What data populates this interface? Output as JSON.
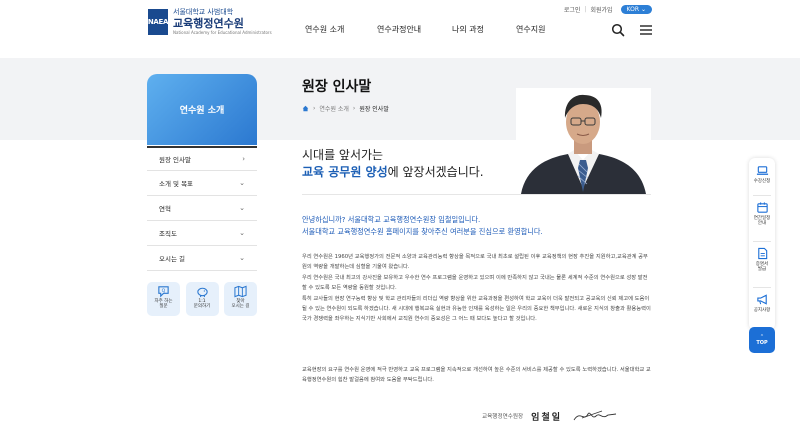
{
  "header": {
    "logo_mark": "NAEA",
    "logo_sub": "서울대학교 사범대학",
    "logo_main": "교육행정연수원",
    "logo_en": "National Academy for Educational Administrators",
    "util": {
      "login": "로그인",
      "signup": "회원가입",
      "lang": "KOR"
    },
    "nav": [
      "연수원 소개",
      "연수과정안내",
      "나의 과정",
      "연수지원"
    ]
  },
  "page": {
    "title": "원장 인사말",
    "breadcrumb": [
      "연수원 소개",
      "원장 인사말"
    ]
  },
  "sidebar": {
    "hero_label": "연수원 소개",
    "items": [
      {
        "label": "원장 인사말",
        "chevron": "›"
      },
      {
        "label": "소개 및 목표",
        "chevron": "⌄"
      },
      {
        "label": "연혁",
        "chevron": "⌄"
      },
      {
        "label": "조직도",
        "chevron": "⌄"
      },
      {
        "label": "오시는 길",
        "chevron": "⌄"
      }
    ],
    "quick": [
      {
        "line1": "자주 하는",
        "line2": "질문",
        "icon": "faq-icon"
      },
      {
        "line1": "1:1",
        "line2": "문의하기",
        "icon": "piggy-icon"
      },
      {
        "line1": "찾아",
        "line2": "오시는 길",
        "icon": "map-icon"
      }
    ]
  },
  "greeting": {
    "headline_1": "시대를 앞서가는",
    "headline_2_highlight": "교육 공무원 양성",
    "headline_2_rest": "에 앞장서겠습니다.",
    "lead_1": "안녕하십니까? 서울대학교 교육행정연수원장 임철일입니다.",
    "lead_2": "서울대학교 교육행정연수원 홈페이지를 찾아주신 여러분을 진심으로 환영합니다.",
    "body_1": "우리 연수원은 1960년 교육행정가의 전문적 소양과 교육관리능력 향상을 목적으로 국내 최초로 설립된 이후 교육정책의 현장 추진을 지원하고,교육관계 공무원의 역량을 개발하는데 심혈을 기울여 왔습니다.",
    "body_2": "우리 연수원은 국내 최고의 강사진을 보유하고 우수한 연수 프로그램을 운영하고 있으며 이에 만족하지 않고 국내는 물론 세계적 수준의 연수원으로 성장 발전할 수 있도록 모든 역량을 동원할 것입니다.",
    "body_3": "특히 교사들의 현장 연구능력 향상 및 학교 관리자들의 리더십 역량 향상을 위한 교육과정을 편성하여 학교 교육이 더욱 발전되고 공교육의 신뢰 제고에 도움이 될 수 있는 연수원이 되도록 하겠습니다. 새 시대에 행복교육 실현과 유능한 인재를 육성하는 일은 우리의 중요한 책무입니다. 새로운 지식의 창출과 활용능력이 국가 경쟁력을 좌우하는 지식기반 사회에서 교직원 연수의 중요성은 그 어느 때 보다도 높다고 할 것입니다.",
    "body_4": "교육현장의 요구를 연수원 운영에 적극 반영하고 교육 프로그램을 지속적으로 개선하여 높은 수준의 서비스를 제공할 수 있도록 노력하겠습니다. 서울대학교 교육행정연수원의 힘찬 발걸음에 참여와 도움을 부탁드립니다.",
    "sign_label": "교육행정연수원장",
    "sign_name": "임철일"
  },
  "rightbar": [
    {
      "line1": "수강신청",
      "line2": "",
      "icon": "laptop-icon"
    },
    {
      "line1": "연간일정",
      "line2": "안내",
      "icon": "calendar-icon"
    },
    {
      "line1": "증명서",
      "line2": "발급",
      "icon": "document-icon"
    },
    {
      "line1": "공지사항",
      "line2": "",
      "icon": "megaphone-icon"
    }
  ],
  "top_button": "TOP",
  "colors": {
    "accent": "#2b78d0",
    "headline_highlight": "#1c5fb5",
    "lead": "#1f5cb8"
  }
}
